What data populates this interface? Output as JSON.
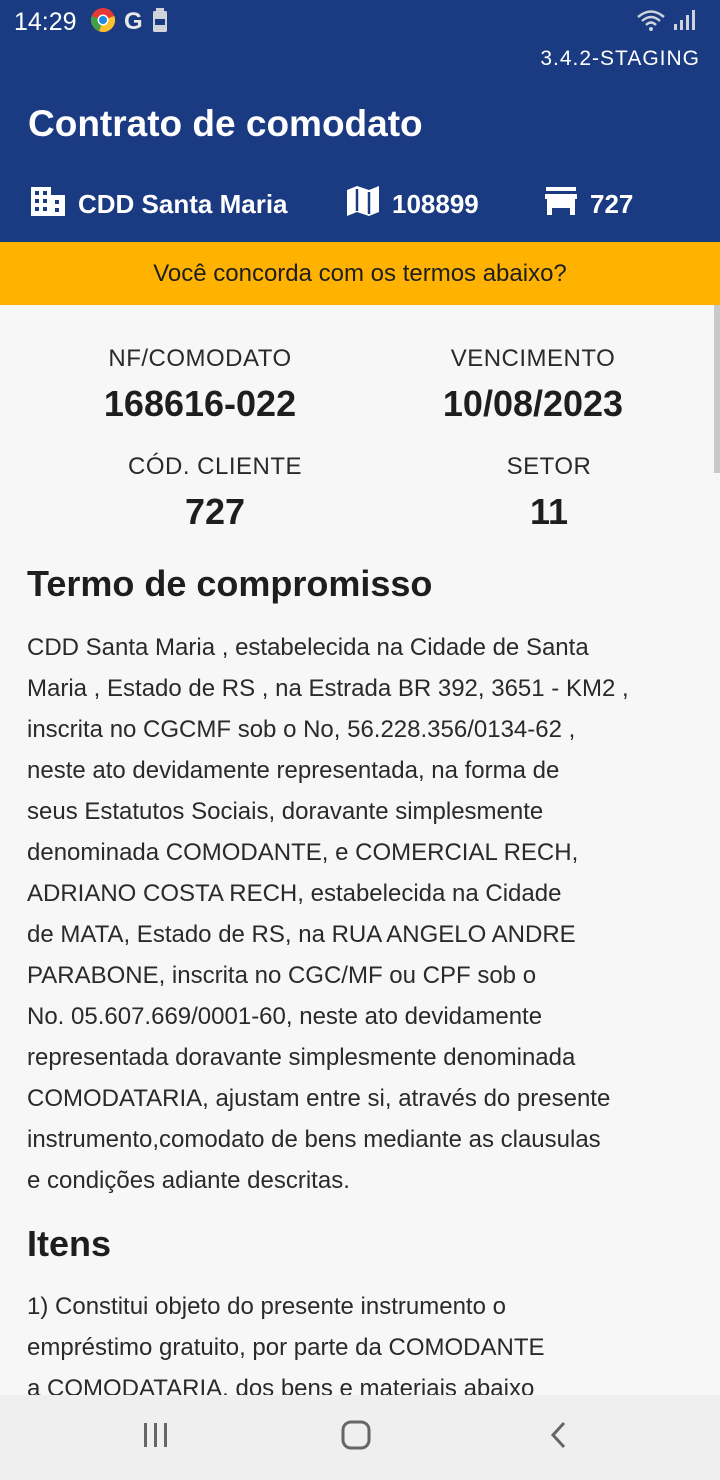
{
  "status_bar": {
    "time": "14:29",
    "left_icons": [
      "chrome-icon",
      "google-icon",
      "battery-saver-icon"
    ],
    "right_icons": [
      "wifi-icon",
      "signal-icon"
    ],
    "g_letter": "G"
  },
  "app": {
    "version": "3.4.2-STAGING",
    "title": "Contrato de comodato",
    "distributor": "CDD Santa Maria",
    "map_code": "108899",
    "store_code": "727"
  },
  "banner": {
    "text": "Você concorda com os termos abaixo?",
    "color": "#ffb300"
  },
  "contract": {
    "nf_label": "NF/COMODATO",
    "nf_value": "168616-022",
    "due_label": "VENCIMENTO",
    "due_value": "10/08/2023",
    "client_label": "CÓD. CLIENTE",
    "client_value": "727",
    "sector_label": "SETOR",
    "sector_value": "11"
  },
  "terms": {
    "title": "Termo de compromisso",
    "lines": [
      "CDD Santa Maria , estabelecida na Cidade de Santa",
      "Maria , Estado de RS , na Estrada BR 392, 3651 - KM2 ,",
      "inscrita no CGCMF sob o No, 56.228.356/0134-62 ,",
      "neste ato devidamente representada, na forma de",
      "seus Estatutos Sociais, doravante simplesmente",
      "denominada COMODANTE, e COMERCIAL RECH,",
      "ADRIANO COSTA RECH, estabelecida na Cidade",
      "de MATA, Estado de RS, na RUA ANGELO ANDRE",
      "PARABONE, inscrita no CGC/MF ou CPF sob o",
      "No. 05.607.669/0001-60, neste ato devidamente",
      "representada doravante simplesmente denominada",
      "COMODATARIA, ajustam entre si, através do presente",
      "instrumento,comodato de bens mediante as clausulas",
      "e condições adiante descritas."
    ]
  },
  "items": {
    "title": "Itens",
    "lines": [
      "1) Constitui objeto do presente instrumento o",
      "empréstimo gratuito, por parte da COMODANTE",
      "a COMODATARIA, dos  bens  e materiais abaixo"
    ]
  },
  "colors": {
    "header": "#1a3a82",
    "banner": "#ffb300",
    "background": "#f7f7f7"
  }
}
